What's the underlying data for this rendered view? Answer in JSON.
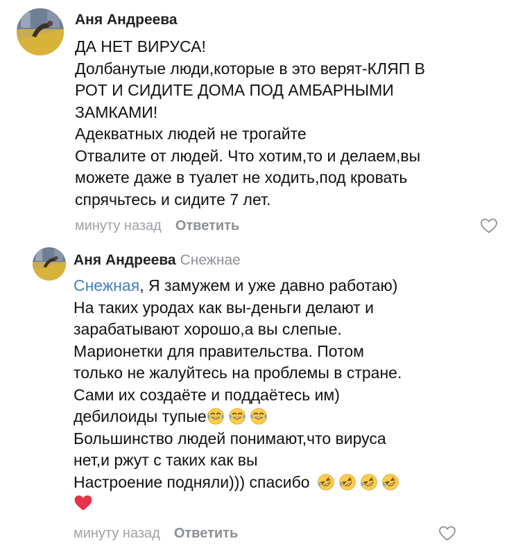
{
  "comments": [
    {
      "author": "Аня Андреева",
      "lines": [
        "ДА НЕТ ВИРУСА!",
        "Долбанутые люди,которые в это верят-КЛЯП В",
        "РОТ И СИДИТЕ ДОМА ПОД АМБАРНЫМИ",
        "ЗАМКАМИ!",
        "Адекватных людей не трогайте",
        "Отвалите от людей. Что хотим,то и делаем,вы",
        "можете даже в туалет не ходить,под кровать",
        "спрячьтесь и сидите 7 лет."
      ],
      "time": "минуту назад",
      "reply_label": "Ответить",
      "like_icon": "heart-outline-icon"
    },
    {
      "author": "Аня Андреева",
      "reply_to": "Снежнае",
      "mention": "Снежная",
      "first_line_rest": ", Я замужем и уже давно работаю)",
      "lines": [
        "На таких уродах как вы-деньги делают и",
        "зарабатывают хорошо,а вы слепые.",
        "Марионетки для правительства. Потом",
        "только не жалуйтесь на проблемы в стране.",
        "Сами их создаёте и поддаётесь им)"
      ],
      "line_with_emoji_1": "дебилоиды тупые",
      "lines_2": [
        "Большинство людей понимают,что вируса",
        "нет,и ржут с таких как вы"
      ],
      "line_with_emoji_2": "Настроение подняли))) спасибо",
      "time": "минуту назад",
      "reply_label": "Ответить",
      "like_icon": "heart-outline-icon"
    }
  ],
  "emoji": {
    "crying_laughing": "face-with-tears-of-joy",
    "rofl": "rolling-on-floor-laughing",
    "heart": "red-heart"
  },
  "colors": {
    "mention": "#3f7fc1",
    "meta": "#9ea2a8",
    "heart": "#e8324a"
  }
}
